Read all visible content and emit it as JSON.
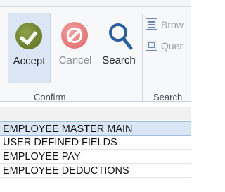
{
  "ribbon": {
    "accept_label": "Accept",
    "cancel_label": "Cancel",
    "search_label": "Search",
    "browse_label": "Brow",
    "query_label": "Quer",
    "groups": {
      "confirm": "Confirm",
      "search": "Search"
    }
  },
  "list": {
    "items": [
      {
        "label": "EMPLOYEE MASTER MAIN",
        "selected": true
      },
      {
        "label": "USER DEFINED FIELDS",
        "selected": false
      },
      {
        "label": "EMPLOYEE PAY",
        "selected": false
      },
      {
        "label": "EMPLOYEE DEDUCTIONS",
        "selected": false
      }
    ]
  },
  "colors": {
    "accent": "#dbe6f4",
    "accept_icon": "#6a7d2c",
    "cancel_icon": "#e37474",
    "search_icon": "#2b5f9e"
  },
  "icons": {
    "accept": "checkmark-circle-icon",
    "cancel": "cancel-circle-icon",
    "search": "magnifier-icon",
    "browse": "browse-list-icon",
    "query": "query-grid-icon"
  }
}
